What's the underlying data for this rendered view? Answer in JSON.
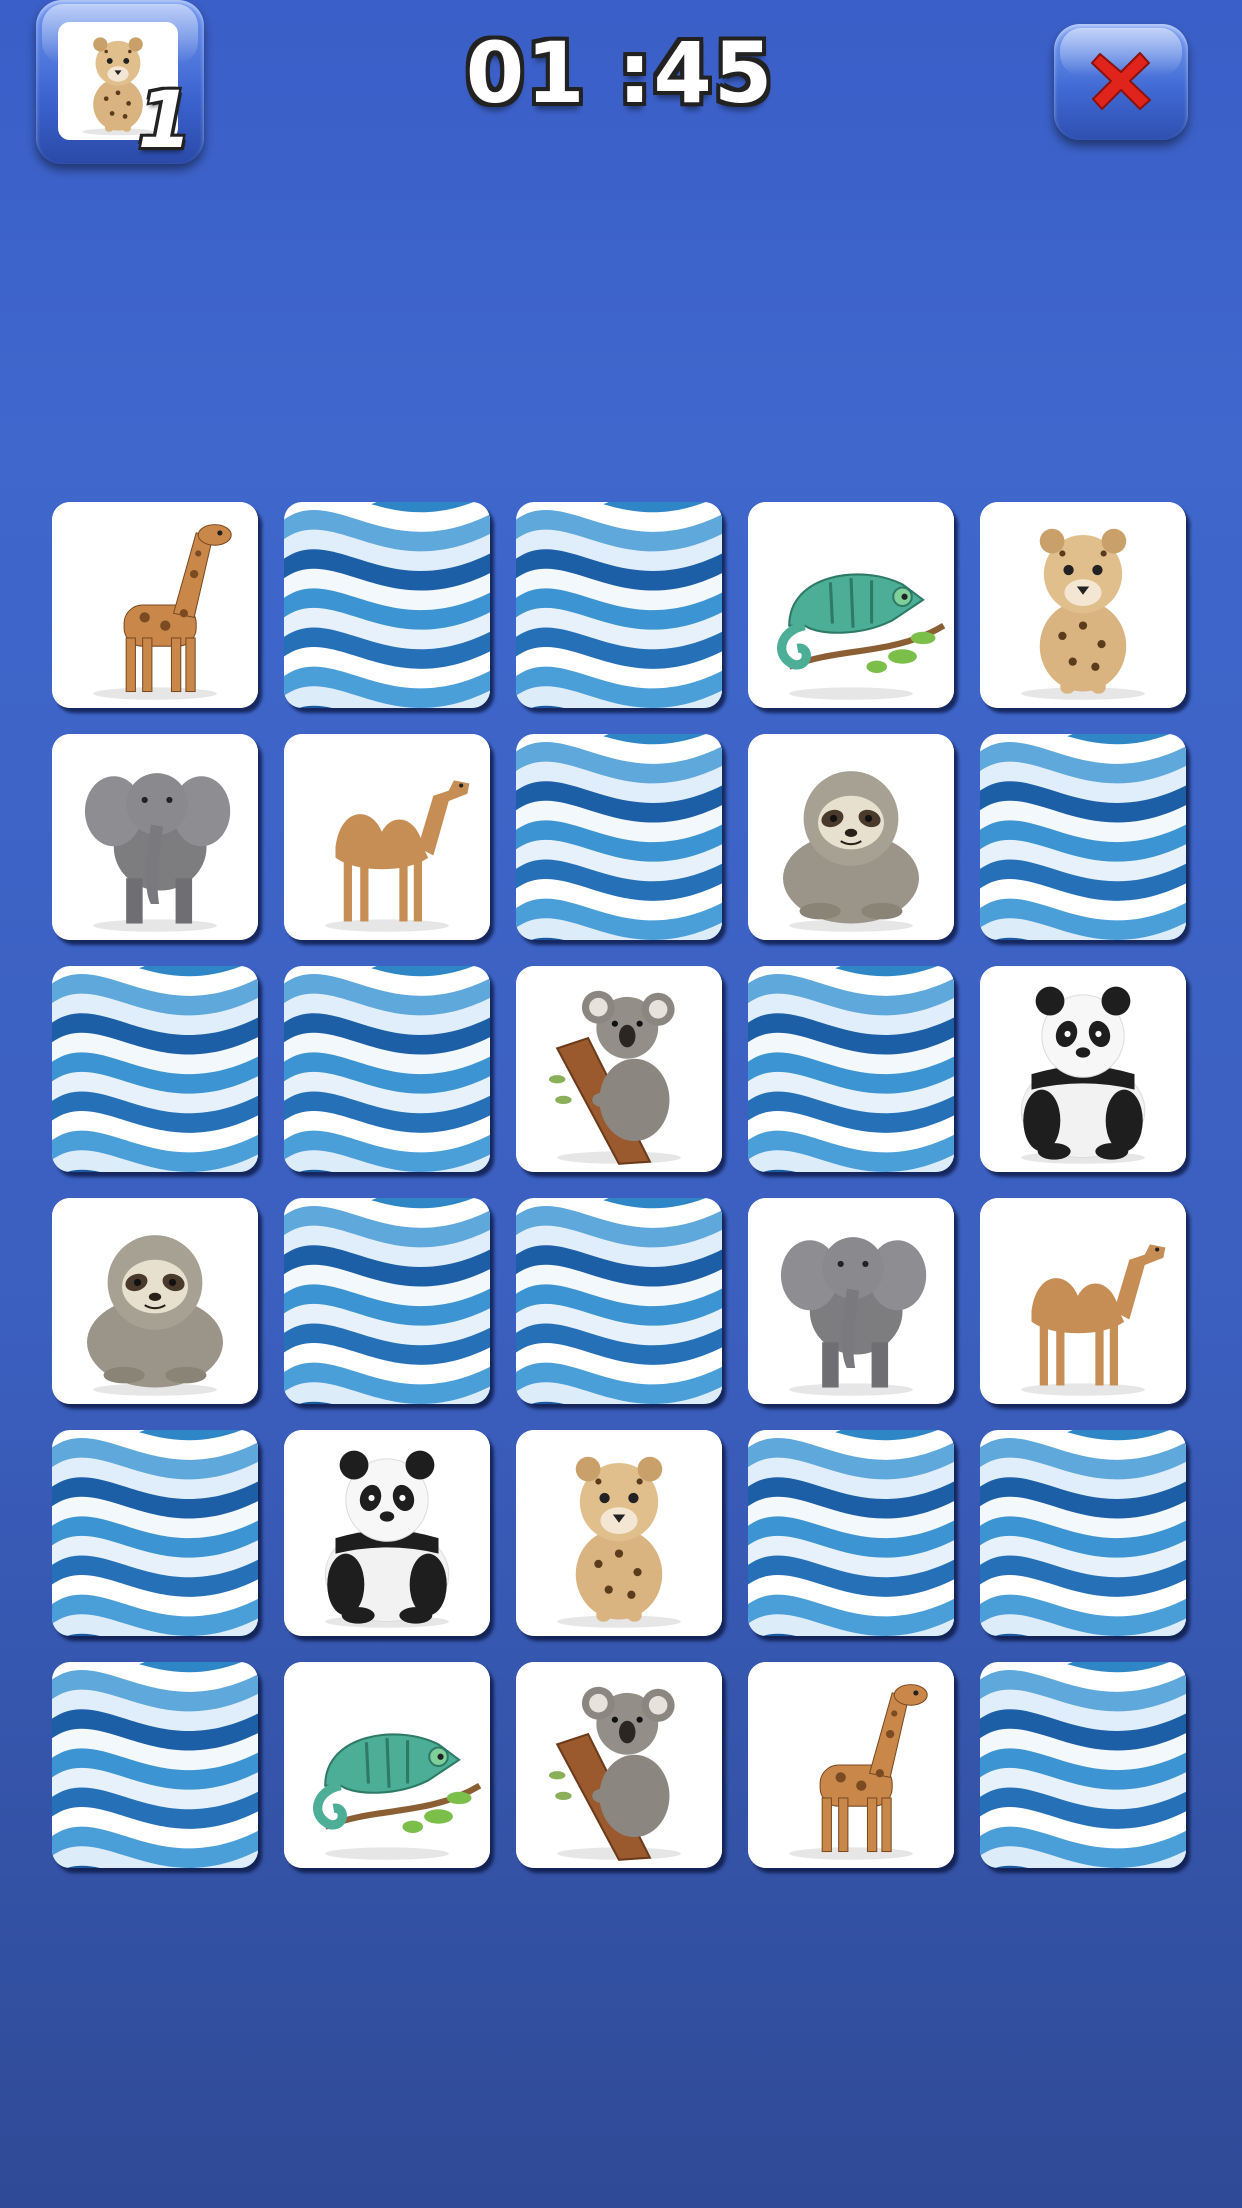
{
  "header": {
    "matched_animal": "cheetah",
    "matched_count": "1",
    "timer": "01 :45",
    "close_icon": "close-x-icon"
  },
  "board": {
    "columns": 5,
    "rows": 6,
    "card_back": "blue-wave-pattern",
    "cards": [
      {
        "state": "up",
        "animal": "giraffe"
      },
      {
        "state": "down",
        "animal": ""
      },
      {
        "state": "down",
        "animal": ""
      },
      {
        "state": "up",
        "animal": "chameleon"
      },
      {
        "state": "up",
        "animal": "cheetah"
      },
      {
        "state": "up",
        "animal": "elephant"
      },
      {
        "state": "up",
        "animal": "camel"
      },
      {
        "state": "down",
        "animal": ""
      },
      {
        "state": "up",
        "animal": "sloth"
      },
      {
        "state": "down",
        "animal": ""
      },
      {
        "state": "down",
        "animal": ""
      },
      {
        "state": "down",
        "animal": ""
      },
      {
        "state": "up",
        "animal": "koala"
      },
      {
        "state": "down",
        "animal": ""
      },
      {
        "state": "up",
        "animal": "panda"
      },
      {
        "state": "up",
        "animal": "sloth"
      },
      {
        "state": "down",
        "animal": ""
      },
      {
        "state": "down",
        "animal": ""
      },
      {
        "state": "up",
        "animal": "elephant"
      },
      {
        "state": "up",
        "animal": "camel"
      },
      {
        "state": "down",
        "animal": ""
      },
      {
        "state": "up",
        "animal": "panda"
      },
      {
        "state": "up",
        "animal": "cheetah"
      },
      {
        "state": "down",
        "animal": ""
      },
      {
        "state": "down",
        "animal": ""
      },
      {
        "state": "down",
        "animal": ""
      },
      {
        "state": "up",
        "animal": "chameleon"
      },
      {
        "state": "up",
        "animal": "koala"
      },
      {
        "state": "up",
        "animal": "giraffe"
      },
      {
        "state": "down",
        "animal": ""
      }
    ]
  },
  "colors": {
    "background": "#3a5fc8",
    "card_back_dark": "#1f5fa8",
    "card_back_light": "#e8f2fb",
    "close_x": "#e0241b"
  }
}
